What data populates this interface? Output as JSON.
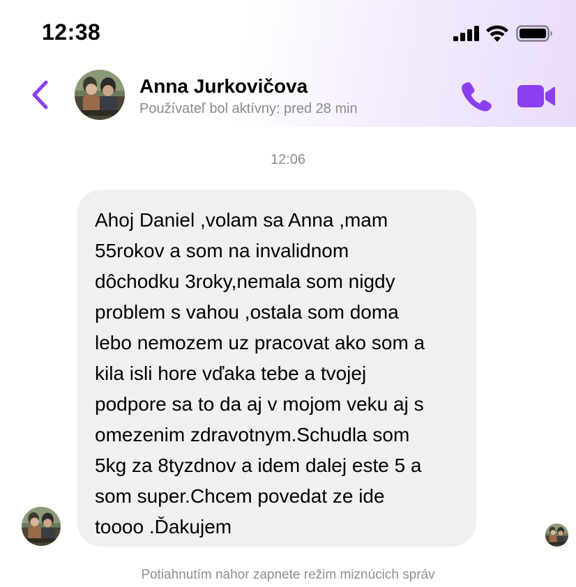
{
  "status_bar": {
    "time": "12:38",
    "icons": [
      "cellular-signal-icon",
      "wifi-icon",
      "battery-icon"
    ]
  },
  "header": {
    "back_icon": "chevron-left-icon",
    "contact_name": "Anna Jurkovičova",
    "contact_status": "Používateľ bol aktívny: pred 28 min",
    "call_icon": "phone-icon",
    "video_icon": "video-camera-icon",
    "accent_color": "#8a3ff0"
  },
  "conversation": {
    "timestamp": "12:06",
    "messages": [
      {
        "sender": "Anna Jurkovičova",
        "text": "Ahoj Daniel ,volam sa Anna ,mam\n55rokov a som na invalidnom\ndôchodku 3roky,nemala som nigdy\nproblem s vahou ,ostala som doma\nlebo nemozem uz pracovat ako som a\nkila isli hore vďaka tebe a tvojej\npodpore sa to da aj v mojom veku aj s\nomezenim zdravotnym.Schudla som\n5kg za 8tyzdnov a idem dalej este 5 a\nsom super.Chcem povedat ze ide\ntoooo .Ďakujem"
      }
    ],
    "bubble_color": "#f0f0f0"
  },
  "footer": {
    "hint": "Potiahnutím nahor zapnete režim miznúcich správ"
  }
}
